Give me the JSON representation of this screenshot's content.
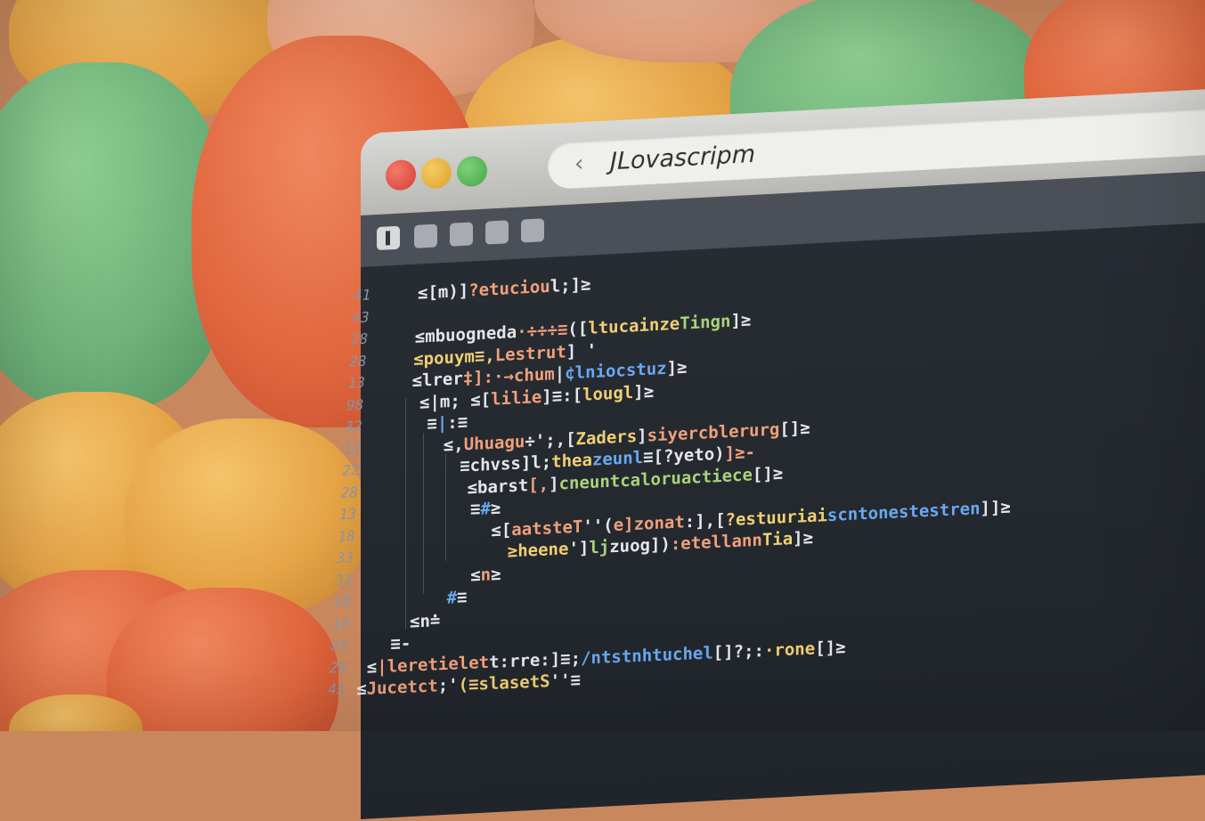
{
  "address_bar": {
    "back_icon": "chevron-left-icon",
    "text": "JLovascripm"
  },
  "toolbar": {
    "buttons": [
      "square-button-icon",
      "square-button-icon",
      "square-button-icon",
      "square-button-icon",
      "square-button-icon"
    ]
  },
  "code_lines": [
    {
      "num": "41",
      "parts": [
        [
          "w",
          "≤[m)]"
        ],
        [
          "o",
          "?etuciou"
        ],
        [
          "w",
          "l;]≥"
        ]
      ]
    },
    {
      "num": "43",
      "parts": []
    },
    {
      "num": "28",
      "parts": [
        [
          "w",
          "≤mbuogneda"
        ],
        [
          "o",
          "·÷÷÷≡"
        ],
        [
          "w",
          "(["
        ],
        [
          "y",
          "ltucainze"
        ],
        [
          "g",
          "Tingn"
        ],
        [
          "w",
          "]≥"
        ]
      ]
    },
    {
      "num": "28",
      "parts": [
        [
          "y",
          "≤pouym≡,"
        ],
        [
          "o",
          "Lestrut"
        ],
        [
          "w",
          "] '"
        ]
      ]
    },
    {
      "num": "13",
      "parts": [
        [
          "w",
          "≤lrer"
        ],
        [
          "o",
          "‡]:·→chum"
        ],
        [
          "w",
          "|"
        ],
        [
          "b",
          "¢lniocstuz"
        ],
        [
          "w",
          "]≥"
        ]
      ]
    },
    {
      "num": "98",
      "parts": [
        [
          "w",
          "≤|m;   ≤["
        ],
        [
          "o",
          "lilie"
        ],
        [
          "w",
          "]≡:["
        ],
        [
          "y",
          "lougl"
        ],
        [
          "w",
          "]≥"
        ]
      ]
    },
    {
      "num": "32",
      "parts": [
        [
          "w",
          "≡"
        ],
        [
          "b",
          "|"
        ],
        [
          "w",
          ":≡"
        ]
      ]
    },
    {
      "num": "13",
      "parts": [
        [
          "w",
          "≤,"
        ],
        [
          "o",
          "Uhuagu"
        ],
        [
          "w",
          "÷';,["
        ],
        [
          "y",
          "Zaders"
        ],
        [
          "w",
          "]"
        ],
        [
          "o",
          "siyercblerurg"
        ],
        [
          "w",
          "[]≥"
        ]
      ]
    },
    {
      "num": "22",
      "parts": [
        [
          "w",
          "≡chvss]l;"
        ],
        [
          "y",
          "thea"
        ],
        [
          "b",
          "zeunl"
        ],
        [
          "w",
          "≡[?yeto)"
        ],
        [
          "o",
          "]≥-"
        ]
      ]
    },
    {
      "num": "28",
      "parts": [
        [
          "w",
          "≤barst"
        ],
        [
          "o",
          "[‚"
        ],
        [
          "w",
          "]"
        ],
        [
          "g",
          "cneuntcaloruactiece"
        ],
        [
          "w",
          "[]≥"
        ]
      ]
    },
    {
      "num": "13",
      "parts": [
        [
          "w",
          "≡"
        ],
        [
          "b",
          "#"
        ],
        [
          "w",
          "≥"
        ]
      ]
    },
    {
      "num": "18",
      "parts": [
        [
          "w",
          "≤["
        ],
        [
          "o",
          "aatsteT"
        ],
        [
          "w",
          "''("
        ],
        [
          "o",
          "e]zonat"
        ],
        [
          "w",
          ":],["
        ],
        [
          "y",
          "?estuuriai"
        ],
        [
          "b",
          "scntonestestren"
        ],
        [
          "w",
          "]]≥"
        ]
      ]
    },
    {
      "num": "33",
      "parts": [
        [
          "y",
          "≥heene"
        ],
        [
          "w",
          "']"
        ],
        [
          "g",
          "lj"
        ],
        [
          "w",
          "zuog])"
        ],
        [
          "o",
          ":etellann"
        ],
        [
          "y",
          "Tia"
        ],
        [
          "w",
          "]≥"
        ]
      ]
    },
    {
      "num": "33",
      "parts": [
        [
          "w",
          "≤"
        ],
        [
          "o",
          "n"
        ],
        [
          "w",
          "≥"
        ]
      ]
    },
    {
      "num": "18",
      "parts": [
        [
          "b",
          "#"
        ],
        [
          "w",
          "≡"
        ]
      ]
    },
    {
      "num": "18",
      "parts": [
        [
          "w",
          "≤n≐"
        ]
      ]
    },
    {
      "num": "22",
      "parts": [
        [
          "w",
          "≡-"
        ]
      ]
    },
    {
      "num": "28",
      "parts": [
        [
          "w",
          "≤"
        ],
        [
          "o",
          "|leretielet"
        ],
        [
          "w",
          "t:rre:"
        ],
        [
          "w",
          "]≡;"
        ],
        [
          "b",
          "/ntstnhtuchel"
        ],
        [
          "w",
          "[]?;:"
        ],
        [
          "y",
          "·rone"
        ],
        [
          "w",
          "[]≥"
        ]
      ]
    },
    {
      "num": "45",
      "parts": [
        [
          "w",
          "≤"
        ],
        [
          "o",
          "Jucetct"
        ],
        [
          "w",
          ";'"
        ],
        [
          "y",
          "(≡slasetS"
        ],
        [
          "w",
          "''≡"
        ]
      ]
    }
  ]
}
